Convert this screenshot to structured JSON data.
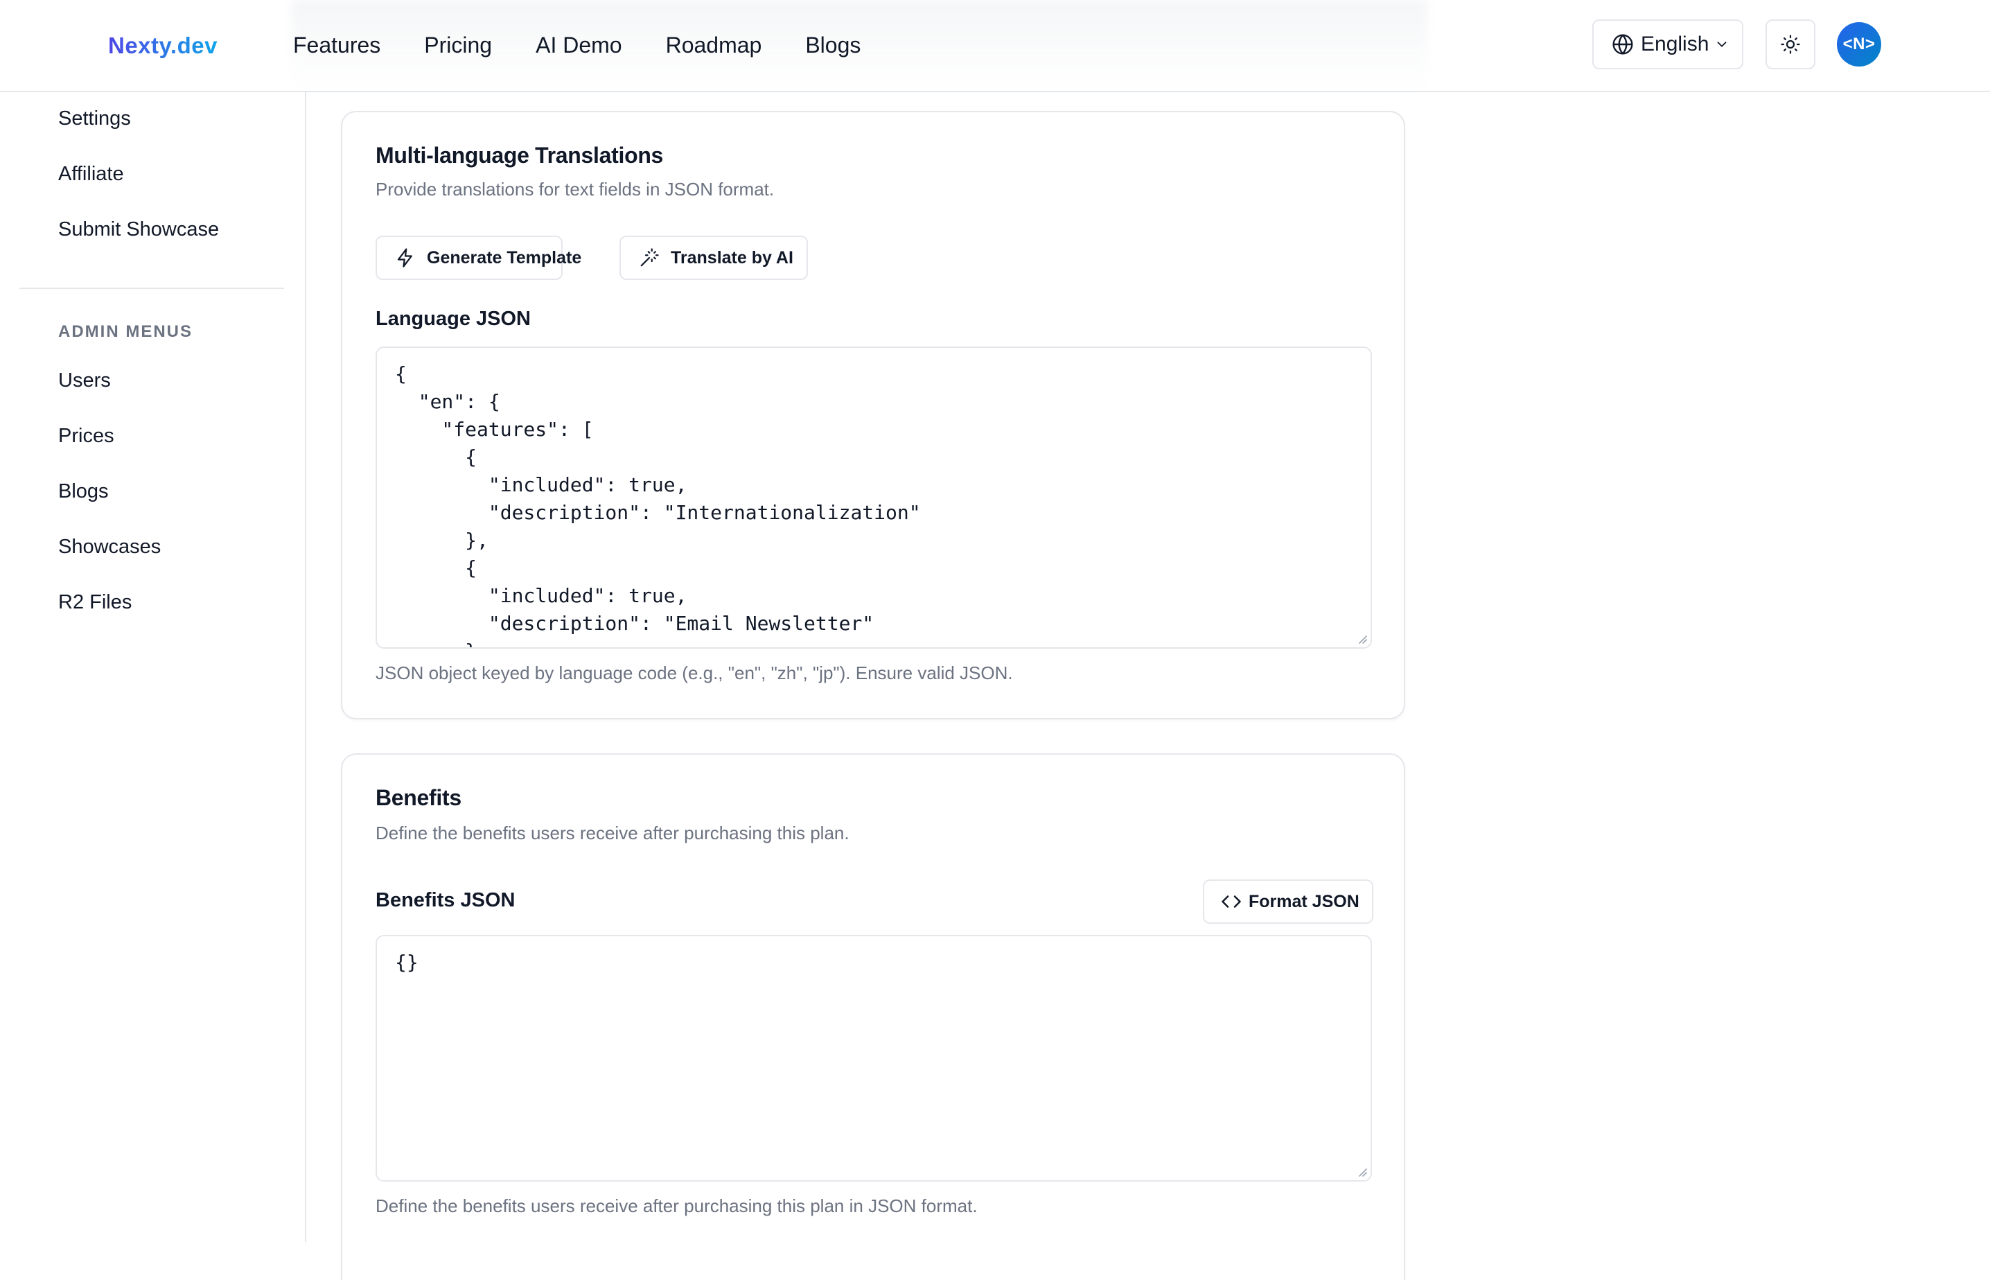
{
  "header": {
    "logo": "Nexty.dev",
    "nav": [
      "Features",
      "Pricing",
      "AI Demo",
      "Roadmap",
      "Blogs"
    ],
    "language": "English",
    "avatar_text": "<N>",
    "icons": {
      "language": "globe-icon",
      "language_caret": "chevron-down-icon",
      "theme": "sun-icon"
    }
  },
  "sidebar": {
    "items": [
      "Settings",
      "Affiliate",
      "Submit Showcase"
    ],
    "admin_heading": "ADMIN MENUS",
    "admin_items": [
      "Users",
      "Prices",
      "Blogs",
      "Showcases",
      "R2 Files"
    ]
  },
  "translations": {
    "title": "Multi-language Translations",
    "subtitle": "Provide translations for text fields in JSON format.",
    "generate_button": "Generate Template",
    "generate_icon": "lightning-icon",
    "translate_button": "Translate by AI",
    "translate_icon": "magic-wand-icon",
    "field_label": "Language JSON",
    "json_value": "{\n  \"en\": {\n    \"features\": [\n      {\n        \"included\": true,\n        \"description\": \"Internationalization\"\n      },\n      {\n        \"included\": true,\n        \"description\": \"Email Newsletter\"\n      },",
    "help_text": "JSON object keyed by language code (e.g., \"en\", \"zh\", \"jp\"). Ensure valid JSON."
  },
  "benefits": {
    "title": "Benefits",
    "subtitle": "Define the benefits users receive after purchasing this plan.",
    "field_label": "Benefits JSON",
    "format_button": "Format JSON",
    "format_icon": "code-icon",
    "json_value": "{}",
    "help_text": "Define the benefits users receive after purchasing this plan in JSON format."
  },
  "colors": {
    "brand_start": "#4f46e5",
    "brand_end": "#0ea5e9",
    "border": "#e5e7eb",
    "muted_text": "#6b7280"
  }
}
